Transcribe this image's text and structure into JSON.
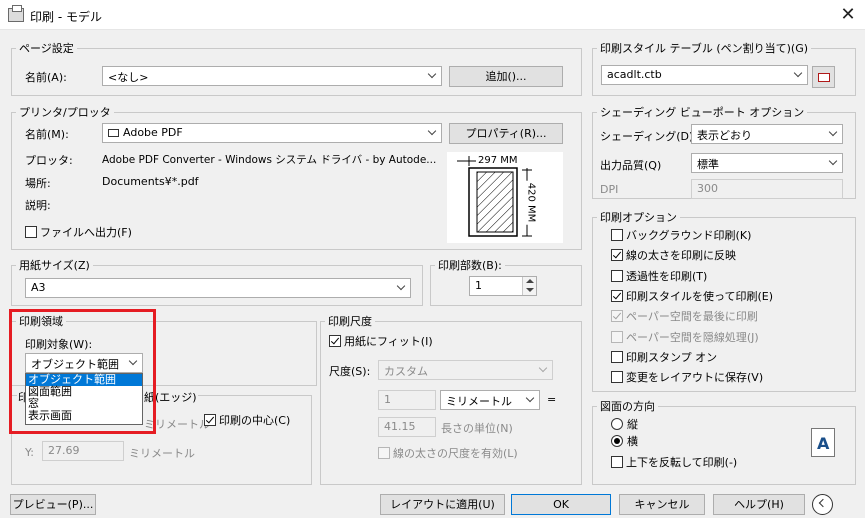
{
  "window": {
    "title": "印刷 - モデル",
    "close": "✕"
  },
  "page_setup": {
    "legend": "ページ設定",
    "name_label": "名前(A):",
    "name_value": "<なし>",
    "add_button": "追加()..."
  },
  "printer": {
    "legend": "プリンタ/プロッタ",
    "name_label": "名前(M):",
    "name_value": "Adobe PDF",
    "properties_button": "プロパティ(R)...",
    "plotter_label": "プロッタ:",
    "plotter_value": "Adobe PDF Converter - Windows システム ドライバ - by Autode...",
    "location_label": "場所:",
    "location_value": "Documents¥*.pdf",
    "description_label": "説明:",
    "print_to_file": "ファイルへ出力(F)",
    "preview": {
      "width": "297  MM",
      "height": "420  MM"
    }
  },
  "paper_size": {
    "legend": "用紙サイズ(Z)",
    "value": "A3"
  },
  "copies": {
    "legend": "印刷部数(B):",
    "value": "1"
  },
  "plot_area": {
    "legend": "印刷領域",
    "what_label": "印刷対象(W):",
    "what_value": "オブジェクト範囲",
    "options": [
      "オブジェクト範囲",
      "図面範囲",
      "窓",
      "表示画面"
    ]
  },
  "plot_offset": {
    "legend_left": "印",
    "legend_right": "紙(エッジ)",
    "x_unit_partial": "ミリメートル",
    "center_label": "印刷の中心(C)",
    "y_label": "Y:",
    "y_value": "27.69",
    "y_unit": "ミリメートル"
  },
  "plot_scale": {
    "legend": "印刷尺度",
    "fit_label": "用紙にフィット(I)",
    "scale_label": "尺度(S):",
    "scale_value": "カスタム",
    "value1": "1",
    "unit_value": "ミリメートル",
    "equals": "=",
    "value2": "41.15",
    "length_unit_label": "長さの単位(N)",
    "lineweight_label": "線の太さの尺度を有効(L)"
  },
  "style_table": {
    "legend": "印刷スタイル テーブル (ペン割り当て)(G)",
    "value": "acadlt.ctb"
  },
  "shaded_viewport": {
    "legend": "シェーディング ビューポート オプション",
    "shade_label": "シェーディング(D)",
    "shade_value": "表示どおり",
    "quality_label": "出力品質(Q)",
    "quality_value": "標準",
    "dpi_label": "DPI",
    "dpi_value": "300"
  },
  "plot_options": {
    "legend": "印刷オプション",
    "items": [
      {
        "label": "バックグラウンド印刷(K)",
        "checked": false,
        "enabled": true
      },
      {
        "label": "線の太さを印刷に反映",
        "checked": true,
        "enabled": true
      },
      {
        "label": "透過性を印刷(T)",
        "checked": false,
        "enabled": true
      },
      {
        "label": "印刷スタイルを使って印刷(E)",
        "checked": true,
        "enabled": true
      },
      {
        "label": "ペーパー空間を最後に印刷",
        "checked": true,
        "enabled": false
      },
      {
        "label": "ペーパー空間を隠線処理(J)",
        "checked": false,
        "enabled": false
      },
      {
        "label": "印刷スタンプ オン",
        "checked": false,
        "enabled": true
      },
      {
        "label": "変更をレイアウトに保存(V)",
        "checked": false,
        "enabled": true
      }
    ]
  },
  "orientation": {
    "legend": "図面の方向",
    "portrait": "縦",
    "landscape": "横",
    "upside_down": "上下を反転して印刷(-)",
    "icon_letter": "A"
  },
  "buttons": {
    "preview": "プレビュー(P)...",
    "apply_layout": "レイアウトに適用(U)",
    "ok": "OK",
    "cancel": "キャンセル",
    "help": "ヘルプ(H)"
  },
  "colors": {
    "highlight": "#e51c23",
    "selection": "#0078d7"
  }
}
